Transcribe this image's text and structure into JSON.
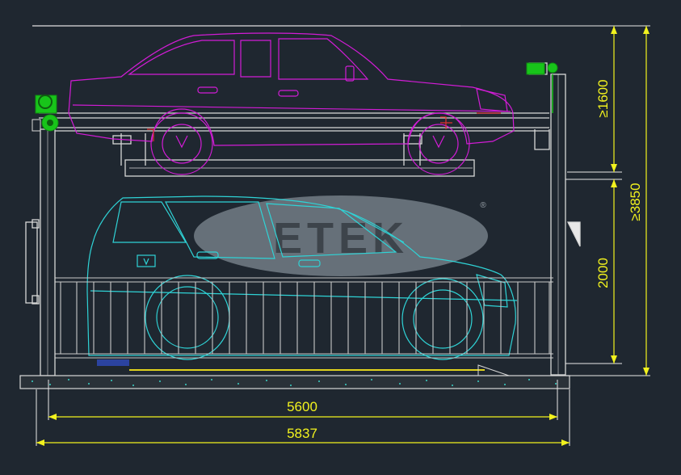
{
  "logo": {
    "text": "ETEK",
    "registered": "®"
  },
  "dimensions": {
    "upper_clearance": "≥1600",
    "total_height": "≥3850",
    "lower_clearance": "2000",
    "inner_width": "5600",
    "overall_width": "5837"
  },
  "colors": {
    "background": "#1f2730",
    "upper_car": "#d21cd6",
    "lower_car": "#2fd3d6",
    "dimension_text": "#f2f21e",
    "structure": "#d8d8d8",
    "motor": "#18c41a",
    "watermark": "#7f8a92"
  }
}
